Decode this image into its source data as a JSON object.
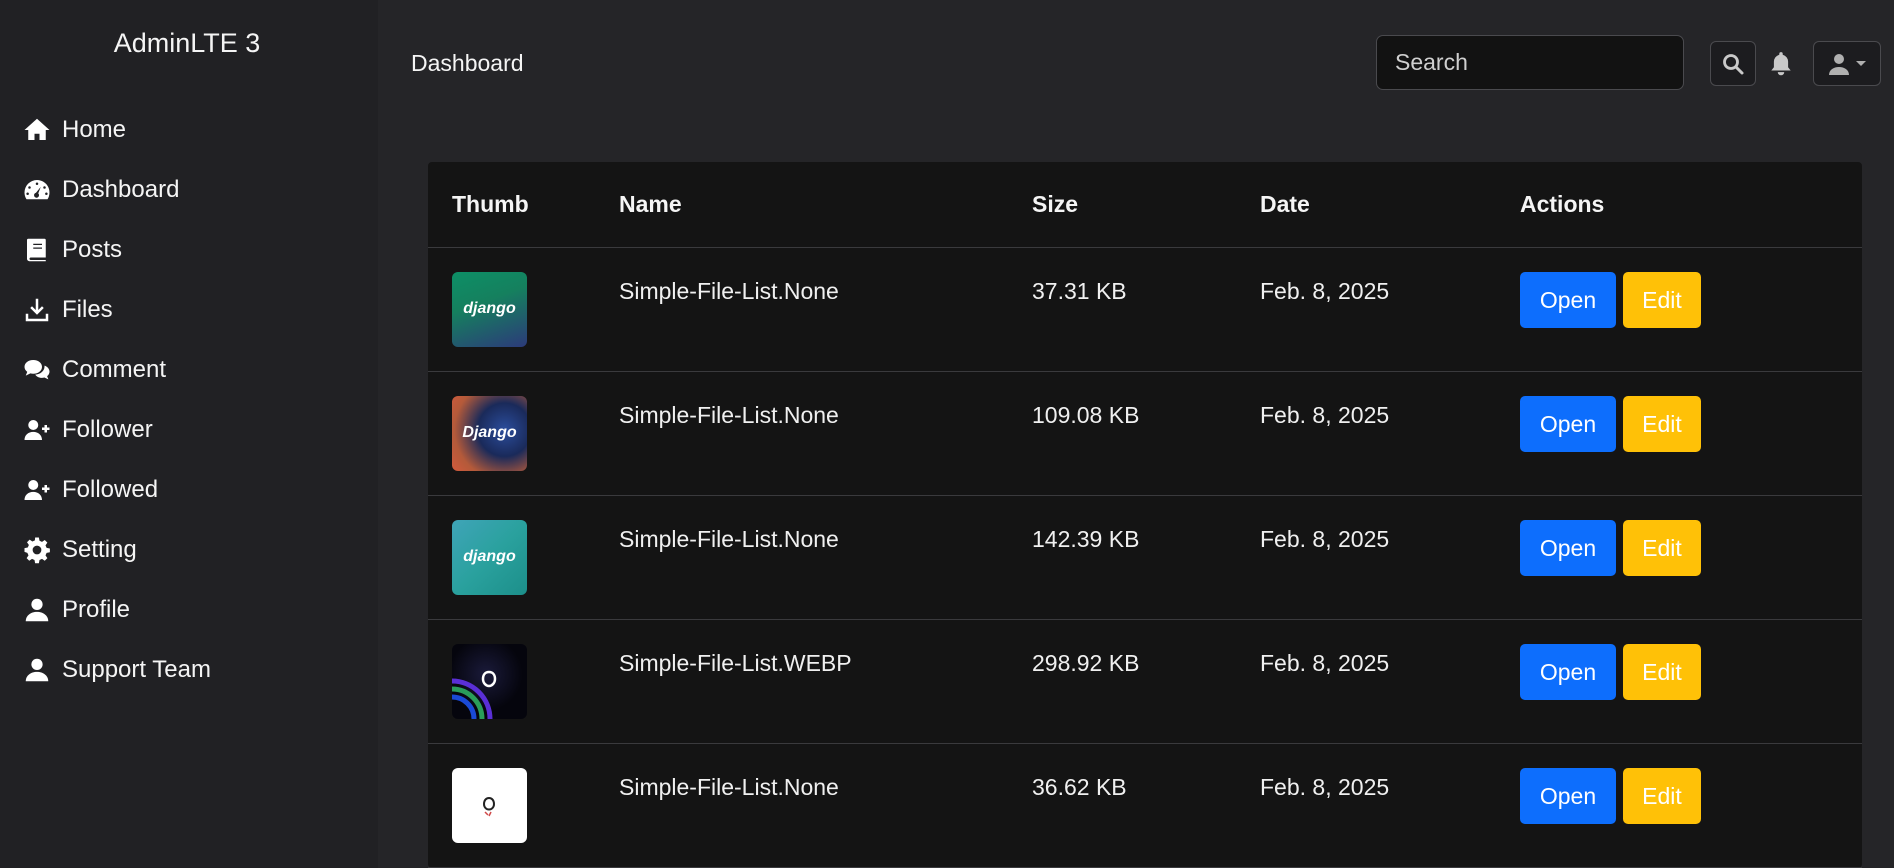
{
  "sidebar": {
    "brand": "AdminLTE 3",
    "items": [
      {
        "label": "Home",
        "icon": "home-icon"
      },
      {
        "label": "Dashboard",
        "icon": "dashboard-gauge-icon"
      },
      {
        "label": "Posts",
        "icon": "book-icon"
      },
      {
        "label": "Files",
        "icon": "download-icon"
      },
      {
        "label": "Comment",
        "icon": "comments-icon"
      },
      {
        "label": "Follower",
        "icon": "user-plus-icon"
      },
      {
        "label": "Followed",
        "icon": "user-plus-icon"
      },
      {
        "label": "Setting",
        "icon": "gear-icon"
      },
      {
        "label": "Profile",
        "icon": "user-icon"
      },
      {
        "label": "Support Team",
        "icon": "user-icon"
      }
    ]
  },
  "header": {
    "title": "Dashboard",
    "search_placeholder": "Search",
    "search_icon": "search-icon",
    "notification_icon": "bell-icon",
    "user_icon": "user-dropdown-icon"
  },
  "table": {
    "columns": [
      "Thumb",
      "Name",
      "Size",
      "Date",
      "Actions"
    ],
    "rows": [
      {
        "thumb_text": "django",
        "name": "Simple-File-List.None",
        "size": "37.31 KB",
        "date": "Feb. 8, 2025"
      },
      {
        "thumb_text": "Django",
        "name": "Simple-File-List.None",
        "size": "109.08 KB",
        "date": "Feb. 8, 2025"
      },
      {
        "thumb_text": "django",
        "name": "Simple-File-List.None",
        "size": "142.39 KB",
        "date": "Feb. 8, 2025"
      },
      {
        "thumb_text": "",
        "name": "Simple-File-List.WEBP",
        "size": "298.92 KB",
        "date": "Feb. 8, 2025"
      },
      {
        "thumb_text": "",
        "name": "Simple-File-List.None",
        "size": "36.62 KB",
        "date": "Feb. 8, 2025"
      }
    ],
    "open_label": "Open",
    "edit_label": "Edit"
  },
  "colors": {
    "open_button": "#0d6efd",
    "edit_button": "#ffc107",
    "sidebar_bg": "#212124",
    "card_bg": "#141414"
  }
}
